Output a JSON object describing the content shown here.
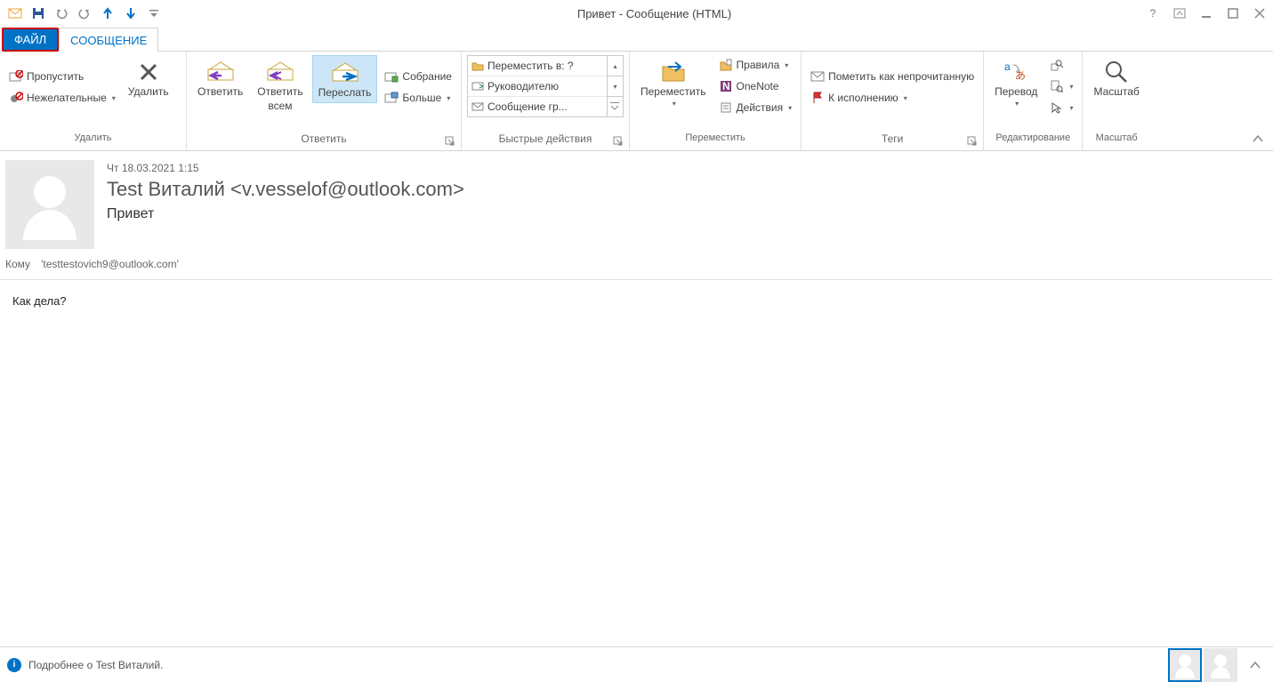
{
  "window_title": "Привет - Сообщение (HTML)",
  "tabs": {
    "file": "ФАЙЛ",
    "message": "СООБЩЕНИЕ"
  },
  "ribbon": {
    "delete": {
      "skip": "Пропустить",
      "junk": "Нежелательные",
      "del": "Удалить",
      "label": "Удалить"
    },
    "respond": {
      "reply": "Ответить",
      "replyall_l1": "Ответить",
      "replyall_l2": "всем",
      "forward": "Переслать",
      "meeting": "Собрание",
      "more": "Больше",
      "label": "Ответить"
    },
    "quicksteps": {
      "moveto": "Переместить в: ?",
      "manager": "Руководителю",
      "teamemail": "Сообщение гр...",
      "label": "Быстрые действия"
    },
    "move": {
      "move": "Переместить",
      "rules": "Правила",
      "onenote": "OneNote",
      "actions": "Действия",
      "label": "Переместить"
    },
    "tags": {
      "unread": "Пометить как непрочитанную",
      "followup": "К исполнению",
      "label": "Теги"
    },
    "editing": {
      "translate": "Перевод",
      "label": "Редактирование"
    },
    "zoom": {
      "zoom": "Масштаб",
      "label": "Масштаб"
    }
  },
  "message": {
    "date": "Чт 18.03.2021 1:15",
    "from": "Test Виталий <v.vesselof@outlook.com>",
    "subject": "Привет",
    "to_label": "Кому",
    "to": "'testtestovich9@outlook.com'",
    "body": "Как дела?"
  },
  "status": "Подробнее о Test Виталий."
}
